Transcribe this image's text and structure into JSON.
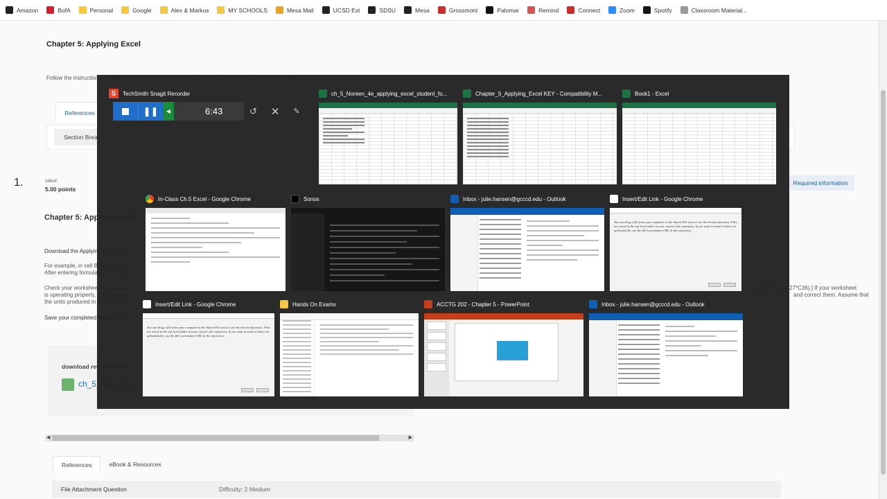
{
  "bookmarks": [
    {
      "label": "Amazon",
      "color": "#222222"
    },
    {
      "label": "BofA",
      "color": "#d4202c"
    },
    {
      "label": "Personal",
      "color": "#f5c842",
      "folder": true
    },
    {
      "label": "Google",
      "color": "#f5c842",
      "folder": true
    },
    {
      "label": "Alex & Markus",
      "color": "#f5c842",
      "folder": true
    },
    {
      "label": "MY SCHOOLS",
      "color": "#f5c842",
      "folder": true
    },
    {
      "label": "Mesa Mail",
      "color": "#e8a32a"
    },
    {
      "label": "UCSD Ext",
      "color": "#222222"
    },
    {
      "label": "SDSU",
      "color": "#222222"
    },
    {
      "label": "Mesa",
      "color": "#222222"
    },
    {
      "label": "Grossmont",
      "color": "#c9302c"
    },
    {
      "label": "Palomar",
      "color": "#111111"
    },
    {
      "label": "Remind",
      "color": "#d9534f"
    },
    {
      "label": "Connect",
      "color": "#c9302c"
    },
    {
      "label": "Zoom",
      "color": "#2d8cff"
    },
    {
      "label": "Spotify",
      "color": "#191414"
    },
    {
      "label": "Classroom Material...",
      "color": "#999999"
    }
  ],
  "page": {
    "title": "Chapter 5: Applying Excel",
    "instructions": "Follow the instructions to create your own worksheet version of Review Problem 1 in the text on pages 192–194",
    "references_tab": "References",
    "section_break": "Section Break",
    "question_number": "1.",
    "value_label": "value:",
    "points": "5.00 points",
    "required_info": "Required information",
    "question_title": "Chapter 5: Applying Excel",
    "p_download": "Download the Applying Excel form",
    "p_example": "For example, in cell B26 enter the",
    "p_after": "After entering formulas in all of the",
    "p_check": "Check your worksheet by changing",
    "p_check_right": "C27-C26)/B26 C27*C36).] If your worksheet",
    "p_operating": "is operating properly, the net oper",
    "p_units": "the units produced in year 2 were",
    "p_units_right": "and correct them. Assume that",
    "p_save": "Save your completed Applying Exc",
    "download_label": "download reference file",
    "file_name": "ch_5_Noreen_4",
    "tab_references": "References",
    "tab_ebook": "eBook & Resources",
    "file_attachment": "File Attachment Question",
    "difficulty": "Difficulty: 2 Medium"
  },
  "switcher": {
    "snagit": {
      "title": "TechSmith Snagit Recorder",
      "time": "6:43",
      "icon_color": "#e8432e"
    },
    "windows": [
      {
        "id": "excel1",
        "title": "ch_5_Noreen_4e_applying_excel_student_fo...",
        "icon": "excel-icon",
        "color": "#1e7145"
      },
      {
        "id": "excel2",
        "title": "Chapter_5_Applying_Excel KEY  -  Compatibility M...",
        "icon": "excel-icon",
        "color": "#1e7145"
      },
      {
        "id": "excel3",
        "title": "Book1 - Excel",
        "icon": "excel-icon",
        "color": "#1e7145"
      },
      {
        "id": "chrome1",
        "title": "In-Class Ch.5 Excel - Google Chrome",
        "icon": "chrome-icon",
        "color": "#4285f4"
      },
      {
        "id": "sonos",
        "title": "Sonos",
        "icon": "sonos-icon",
        "color": "#000000"
      },
      {
        "id": "outlook1",
        "title": "Inbox - julie.hansen@gcccd.edu - Outlook",
        "icon": "outlook-icon",
        "color": "#0f5fb5"
      },
      {
        "id": "chrome2",
        "title": "Insert/Edit Link - Google Chrome",
        "icon": "page-icon",
        "color": "#ffffff"
      },
      {
        "id": "chrome3",
        "title": "Insert/Edit Link - Google Chrome",
        "icon": "page-icon",
        "color": "#ffffff"
      },
      {
        "id": "explorer",
        "title": "Hands On Exams",
        "icon": "folder-icon",
        "color": "#f5c842"
      },
      {
        "id": "ppt",
        "title": "ACCTG 202 - Chapter 5 - PowerPoint",
        "icon": "powerpoint-icon",
        "color": "#c43e1c"
      },
      {
        "id": "outlook2",
        "title": "Inbox - julie.hansen@gcccd.edu - Outlook",
        "icon": "outlook-icon",
        "color": "#0f5fb5"
      }
    ],
    "dialog_text": "You can drag a file from your computer to the Attach File area or use the browse functions. Files are saved in the top-level folder in your course's file repository. If you want to email a link to an uploaded file, use the file's permanent URL in the repository."
  }
}
